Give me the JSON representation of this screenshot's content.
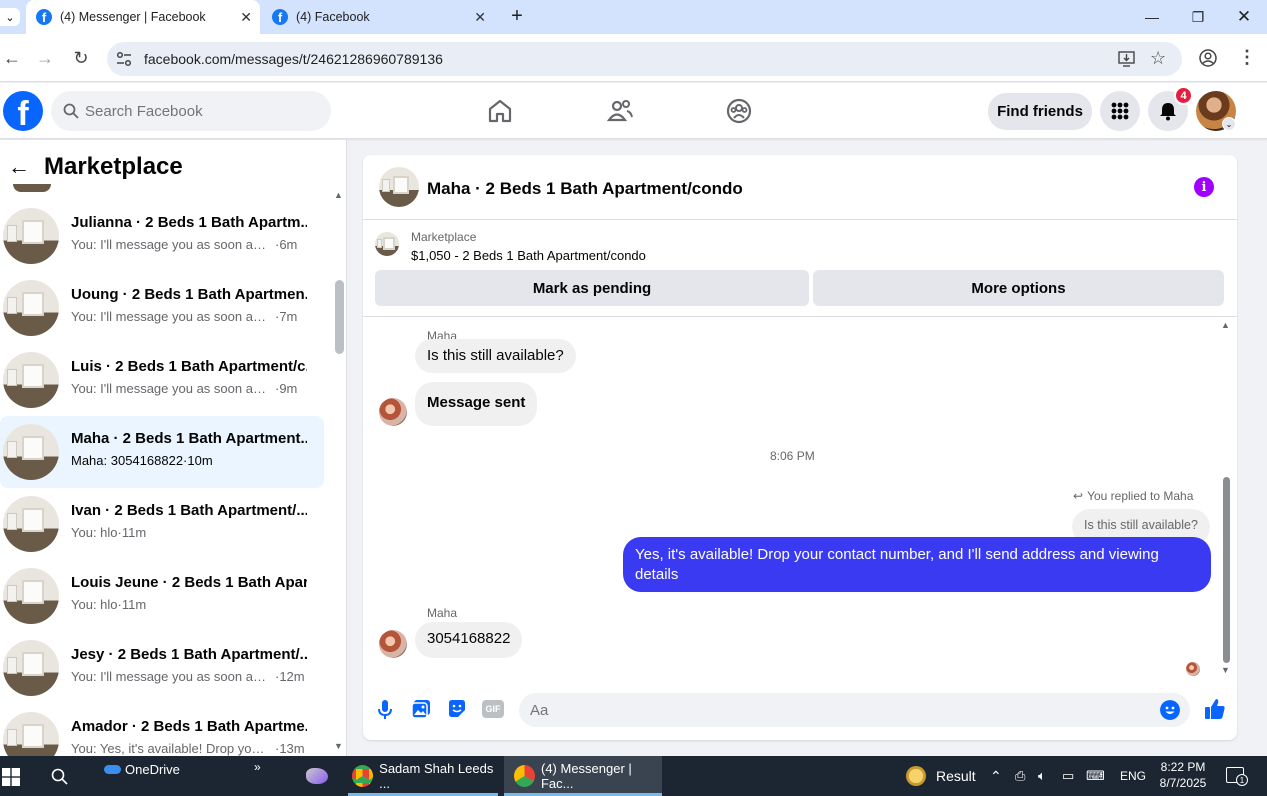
{
  "browser": {
    "tabs": [
      {
        "label": "(4) Messenger | Facebook",
        "active": true
      },
      {
        "label": "(4) Facebook",
        "active": false
      }
    ],
    "url": "facebook.com/messages/t/24621286960789136"
  },
  "fb": {
    "search_placeholder": "Search Facebook",
    "find_friends": "Find friends",
    "notification_count": "4"
  },
  "sidebar": {
    "title": "Marketplace",
    "conversations": [
      {
        "name": "Julianna · 2 Beds 1 Bath Apartm...",
        "preview": "You: I'll message you as soon as p...",
        "time": "·6m",
        "active": false
      },
      {
        "name": "Uoung · 2 Beds 1 Bath Apartmen...",
        "preview": "You: I'll message you as soon as p...",
        "time": "·7m",
        "active": false
      },
      {
        "name": "Luis · 2 Beds 1 Bath Apartment/c...",
        "preview": "You: I'll message you as soon as p...",
        "time": "·9m",
        "active": false
      },
      {
        "name": "Maha · 2 Beds 1 Bath Apartment...",
        "preview": "Maha: 3054168822",
        "time": "·10m",
        "active": true
      },
      {
        "name": "Ivan · 2 Beds 1 Bath Apartment/...",
        "preview": "You: hlo",
        "time": "·11m",
        "active": false
      },
      {
        "name": "Louis Jeune · 2 Beds 1 Bath Apar...",
        "preview": "You: hlo",
        "time": "·11m",
        "active": false
      },
      {
        "name": "Jesy · 2 Beds 1 Bath Apartment/...",
        "preview": "You: I'll message you as soon as ...",
        "time": "·12m",
        "active": false
      },
      {
        "name": "Amador · 2 Beds 1 Bath Apartme...",
        "preview": "You: Yes, it's available! Drop your ...",
        "time": "·13m",
        "active": false
      }
    ]
  },
  "chat": {
    "title": "Maha · 2 Beds 1 Bath Apartment/condo",
    "listing_source": "Marketplace",
    "listing_price": "$1,050 - 2 Beds 1 Bath Apartment/condo",
    "mark_pending": "Mark as pending",
    "more_options": "More options",
    "messages": {
      "sender1": "Maha",
      "msg1": "Is this still available?",
      "msg2": "Message sent",
      "timestamp": "8:06 PM",
      "replied_to": "You replied to Maha",
      "quoted": "Is this still available?",
      "my_reply": "Yes, it's available! Drop your contact number, and I'll send address and viewing details",
      "sender2": "Maha",
      "msg3": "3054168822"
    },
    "input_placeholder": "Aa"
  },
  "taskbar": {
    "onedrive": "OneDrive",
    "app1": "Sadam Shah Leeds ...",
    "app2": "(4) Messenger | Fac...",
    "result": "Result",
    "lang": "ENG",
    "time": "8:22 PM",
    "date": "8/7/2025",
    "notif_count": "1"
  }
}
